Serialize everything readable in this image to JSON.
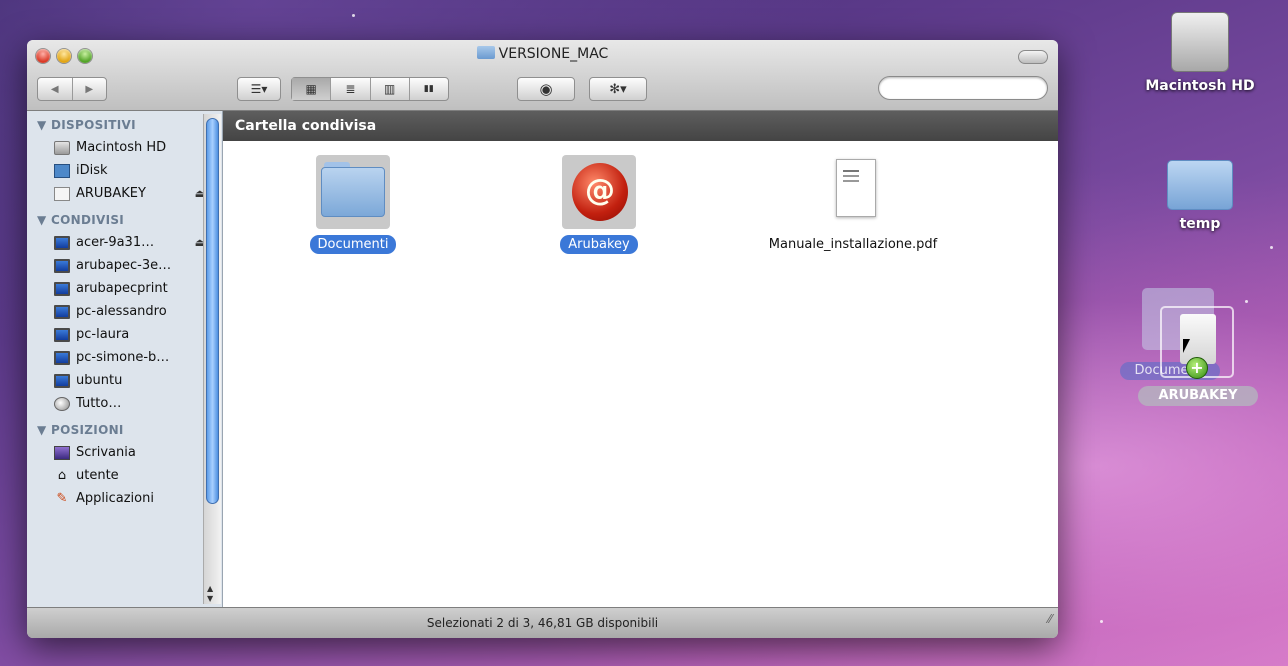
{
  "window": {
    "title": "VERSIONE_MAC",
    "search_placeholder": "",
    "path_title": "Cartella condivisa",
    "status": "Selezionati 2 di 3, 46,81 GB disponibili"
  },
  "sidebar": {
    "sections": [
      {
        "title": "▼ DISPOSITIVI",
        "items": [
          {
            "label": "Macintosh HD",
            "icon": "hard-drive-icon",
            "eject": false
          },
          {
            "label": "iDisk",
            "icon": "idisk-icon",
            "eject": false
          },
          {
            "label": "ARUBAKEY",
            "icon": "usb-drive-icon",
            "eject": true
          }
        ]
      },
      {
        "title": "▼ CONDIVISI",
        "items": [
          {
            "label": "acer-9a31…",
            "icon": "network-computer-icon",
            "eject": true
          },
          {
            "label": "arubapec-3e…",
            "icon": "network-computer-icon",
            "eject": false
          },
          {
            "label": "arubapecprint",
            "icon": "network-computer-icon",
            "eject": false
          },
          {
            "label": "pc-alessandro",
            "icon": "network-computer-icon",
            "eject": false
          },
          {
            "label": "pc-laura",
            "icon": "network-computer-icon",
            "eject": false
          },
          {
            "label": "pc-simone-b…",
            "icon": "network-computer-icon",
            "eject": false
          },
          {
            "label": "ubuntu",
            "icon": "network-computer-icon",
            "eject": false
          },
          {
            "label": "Tutto…",
            "icon": "globe-icon",
            "eject": false
          }
        ]
      },
      {
        "title": "▼ POSIZIONI",
        "items": [
          {
            "label": "Scrivania",
            "icon": "desktop-icon",
            "eject": false
          },
          {
            "label": "utente",
            "icon": "home-icon",
            "eject": false
          },
          {
            "label": "Applicazioni",
            "icon": "applications-icon",
            "eject": false
          }
        ]
      }
    ]
  },
  "files": [
    {
      "name": "Documenti",
      "icon": "folder-icon",
      "selected": true
    },
    {
      "name": "Arubakey",
      "icon": "arubakey-seal-icon",
      "selected": true
    },
    {
      "name": "Manuale_installazione.pdf",
      "icon": "pdf-document-icon",
      "selected": false
    }
  ],
  "desktop": {
    "items": [
      {
        "label": "Macintosh HD",
        "icon": "hard-drive-icon"
      },
      {
        "label": "temp",
        "icon": "folder-icon"
      }
    ],
    "drag_ghost_label": "Documenti",
    "drop_target_label": "ARUBAKEY"
  },
  "toolbar": {
    "back": "◀",
    "forward": "▶",
    "arrange": "☰▾",
    "view_icon": "▦",
    "view_list": "≣",
    "view_columns": "▥",
    "view_coverflow": "▮▮",
    "quicklook": "◉",
    "action": "✻▾",
    "search_glyph": "⚲"
  }
}
